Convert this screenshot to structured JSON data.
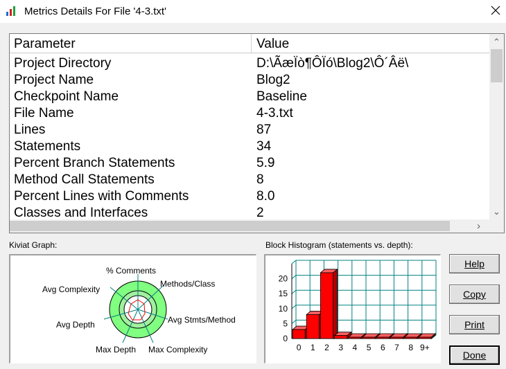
{
  "window": {
    "title": "Metrics Details For File '4-3.txt'"
  },
  "table": {
    "headers": [
      "Parameter",
      "Value"
    ],
    "rows": [
      [
        "Project Directory",
        "D:\\ÃæÏò¶ÔÏó\\Blog2\\Ô´Âë\\"
      ],
      [
        "Project Name",
        "Blog2"
      ],
      [
        "Checkpoint Name",
        "Baseline"
      ],
      [
        "File Name",
        "4-3.txt"
      ],
      [
        "Lines",
        "87"
      ],
      [
        "Statements",
        "34"
      ],
      [
        "Percent Branch Statements",
        "5.9"
      ],
      [
        "Method Call Statements",
        "8"
      ],
      [
        "Percent Lines with Comments",
        "8.0"
      ],
      [
        "Classes and Interfaces",
        "2"
      ]
    ]
  },
  "kiviat": {
    "label": "Kiviat Graph:",
    "axes": [
      "% Comments",
      "Methods/Class",
      "Avg Stmts/Method",
      "Max Complexity",
      "Max Depth",
      "Avg Depth",
      "Avg Complexity"
    ],
    "colors": {
      "ring": "#80ff80",
      "center": "#ffffff",
      "plot": "#ff0000"
    }
  },
  "histogram": {
    "label": "Block Histogram (statements vs. depth):",
    "bar_color": "#ff0000",
    "grid_color": "#008080"
  },
  "chart_data": {
    "type": "bar",
    "categories": [
      "0",
      "1",
      "2",
      "3",
      "4",
      "5",
      "6",
      "7",
      "8",
      "9+"
    ],
    "values": [
      3,
      8,
      22,
      1,
      0,
      0,
      0,
      0,
      0,
      0
    ],
    "yticks": [
      "0",
      "5",
      "10",
      "15",
      "20"
    ],
    "ylim": [
      0,
      25
    ]
  },
  "buttons": {
    "help": "Help",
    "copy": "Copy",
    "print": "Print",
    "done": "Done"
  }
}
